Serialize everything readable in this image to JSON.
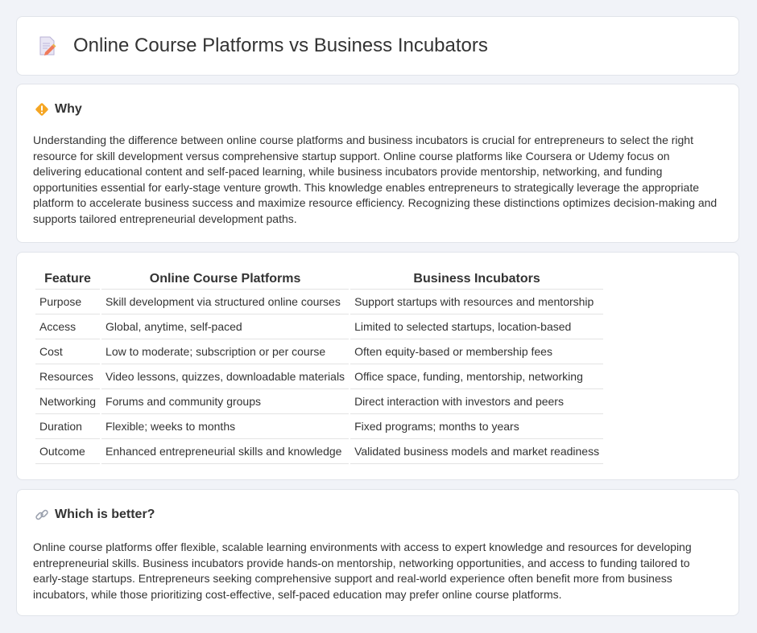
{
  "page": {
    "title": "Online Course Platforms vs Business Incubators"
  },
  "why": {
    "heading": "Why",
    "body": "Understanding the difference between online course platforms and business incubators is crucial for entrepreneurs to select the right resource for skill development versus comprehensive startup support. Online course platforms like Coursera or Udemy focus on delivering educational content and self-paced learning, while business incubators provide mentorship, networking, and funding opportunities essential for early-stage venture growth. This knowledge enables entrepreneurs to strategically leverage the appropriate platform to accelerate business success and maximize resource efficiency. Recognizing these distinctions optimizes decision-making and supports tailored entrepreneurial development paths."
  },
  "table": {
    "headers": [
      "Feature",
      "Online Course Platforms",
      "Business Incubators"
    ],
    "rows": [
      [
        "Purpose",
        "Skill development via structured online courses",
        "Support startups with resources and mentorship"
      ],
      [
        "Access",
        "Global, anytime, self-paced",
        "Limited to selected startups, location-based"
      ],
      [
        "Cost",
        "Low to moderate; subscription or per course",
        "Often equity-based or membership fees"
      ],
      [
        "Resources",
        "Video lessons, quizzes, downloadable materials",
        "Office space, funding, mentorship, networking"
      ],
      [
        "Networking",
        "Forums and community groups",
        "Direct interaction with investors and peers"
      ],
      [
        "Duration",
        "Flexible; weeks to months",
        "Fixed programs; months to years"
      ],
      [
        "Outcome",
        "Enhanced entrepreneurial skills and knowledge",
        "Validated business models and market readiness"
      ]
    ]
  },
  "better": {
    "heading": "Which is better?",
    "body": "Online course platforms offer flexible, scalable learning environments with access to expert knowledge and resources for developing entrepreneurial skills. Business incubators provide hands-on mentorship, networking opportunities, and access to funding tailored to early-stage startups. Entrepreneurs seeking comprehensive support and real-world experience often benefit more from business incubators, while those prioritizing cost-effective, self-paced education may prefer online course platforms."
  },
  "icons": {
    "title": "document-pencil-icon",
    "why": "warning-diamond-icon",
    "better": "link-icon"
  }
}
